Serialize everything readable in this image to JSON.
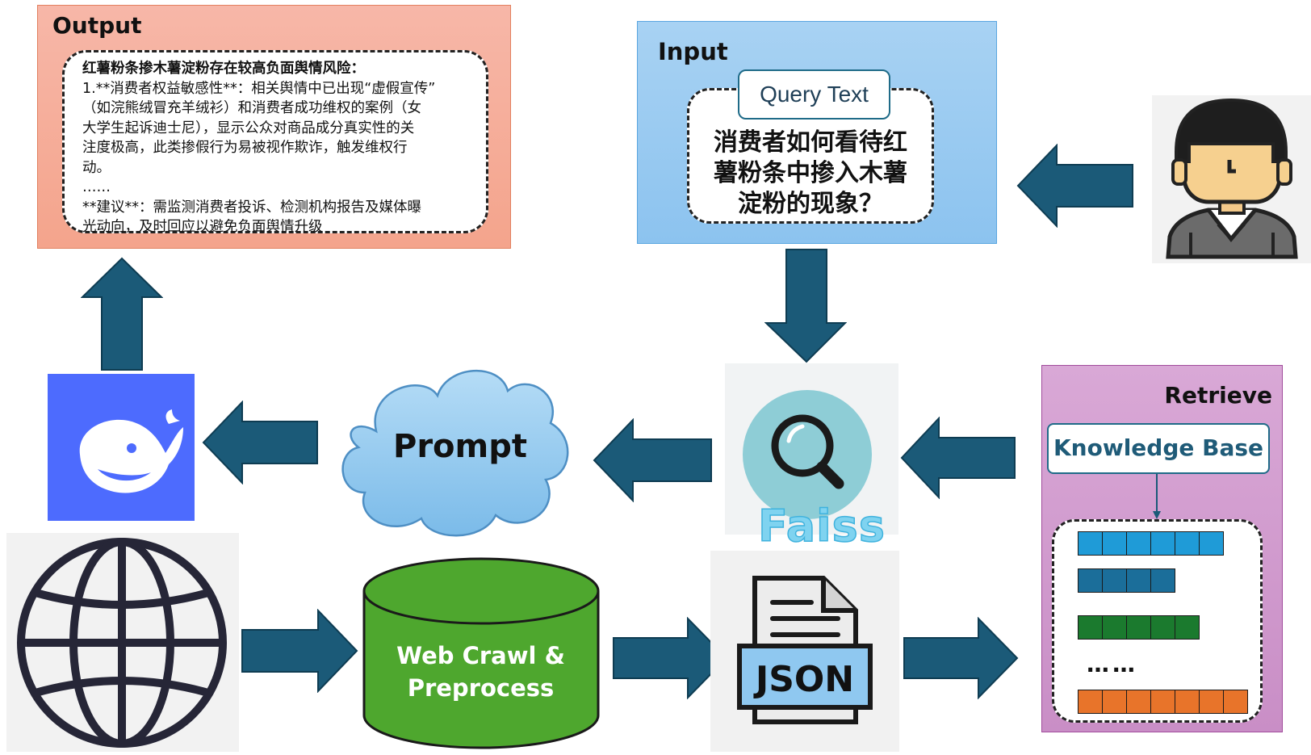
{
  "output": {
    "title": "Output",
    "lines": [
      "红薯粉条掺木薯淀粉存在较高负面舆情风险：",
      "1.**消费者权益敏感性**：相关舆情中已出现“虚假宣传”",
      "（如浣熊绒冒充羊绒衫）和消费者成功维权的案例（女",
      "大学生起诉迪士尼），显示公众对商品成分真实性的关",
      "注度极高，此类掺假行为易被视作欺诈，触发维权行",
      "动。",
      "……",
      "**建议**：需监测消费者投诉、检测机构报告及媒体曝",
      "光动向，及时回应以避免负面舆情升级"
    ]
  },
  "input": {
    "title": "Input",
    "tag": "Query Text",
    "query_lines": [
      "消费者如何看待红",
      "薯粉条中掺入木薯",
      "淀粉的现象？"
    ]
  },
  "prompt": {
    "label": "Prompt"
  },
  "faiss": {
    "label": "Faiss"
  },
  "retrieve": {
    "title": "Retrieve",
    "kb_label": "Knowledge Base",
    "ellipsis": "……"
  },
  "crawl": {
    "line1": "Web Crawl &",
    "line2": "Preprocess"
  },
  "json": {
    "label": "JSON"
  },
  "colors": {
    "arrow": "#1b5a78",
    "arrow_stroke": "#0e3c52",
    "output_bg": "#f4a48c",
    "input_bg": "#8cc3ef",
    "retrieve_bg": "#c98ec6",
    "deepseek_blue": "#4d6bfe",
    "crawl_green": "#4ea72e",
    "vec_blue_light": "#1f9bd7",
    "vec_blue_dark": "#1b6e9a",
    "vec_green": "#1b7a2e",
    "vec_orange": "#e8742a"
  }
}
